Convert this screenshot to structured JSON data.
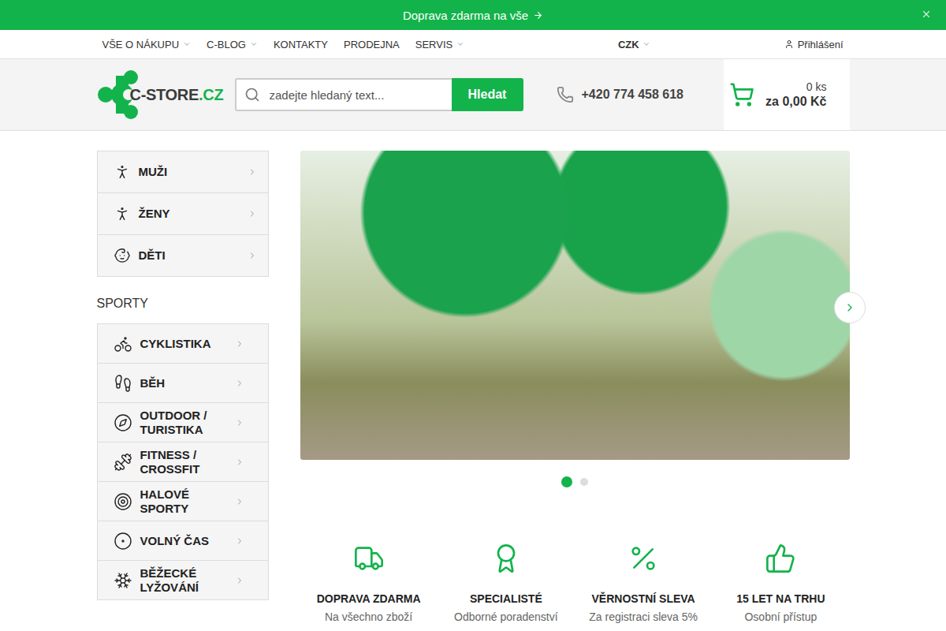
{
  "announcement": {
    "text": "Doprava zdarma na vše"
  },
  "topnav": {
    "items": [
      {
        "label": "VŠE O NÁKUPU",
        "dropdown": true
      },
      {
        "label": "C-BLOG",
        "dropdown": true
      },
      {
        "label": "KONTAKTY",
        "dropdown": false
      },
      {
        "label": "PRODEJNA",
        "dropdown": false
      },
      {
        "label": "SERVIS",
        "dropdown": true
      }
    ],
    "currency": "CZK",
    "login": "Přihlášení"
  },
  "header": {
    "logo": {
      "main": "C-STORE",
      "suffix": ".CZ"
    },
    "search": {
      "placeholder": "zadejte hledaný text...",
      "button": "Hledat"
    },
    "phone": "+420 774 458 618",
    "cart": {
      "count": "0 ks",
      "total": "za 0,00 Kč"
    }
  },
  "categories": [
    {
      "label": "MUŽI"
    },
    {
      "label": "ŽENY"
    },
    {
      "label": "DĚTI"
    }
  ],
  "sports_title": "SPORTY",
  "sports": [
    {
      "label": "CYKLISTIKA"
    },
    {
      "label": "BĚH"
    },
    {
      "label": "OUTDOOR / TURISTIKA"
    },
    {
      "label": "FITNESS / CROSSFIT"
    },
    {
      "label": "HALOVÉ SPORTY"
    },
    {
      "label": "VOLNÝ ČAS"
    },
    {
      "label": "BĚŽECKÉ LYŽOVÁNÍ"
    }
  ],
  "slider": {
    "dots": [
      {
        "selected": true
      },
      {
        "selected": false
      }
    ]
  },
  "features": [
    {
      "title": "DOPRAVA ZDARMA",
      "subtitle": "Na všechno zboží"
    },
    {
      "title": "SPECIALISTÉ",
      "subtitle": "Odborné poradenství"
    },
    {
      "title": "VĚRNOSTNÍ SLEVA",
      "subtitle": "Za registraci sleva 5%"
    },
    {
      "title": "15 LET NA TRHU",
      "subtitle": "Osobní přístup"
    }
  ]
}
